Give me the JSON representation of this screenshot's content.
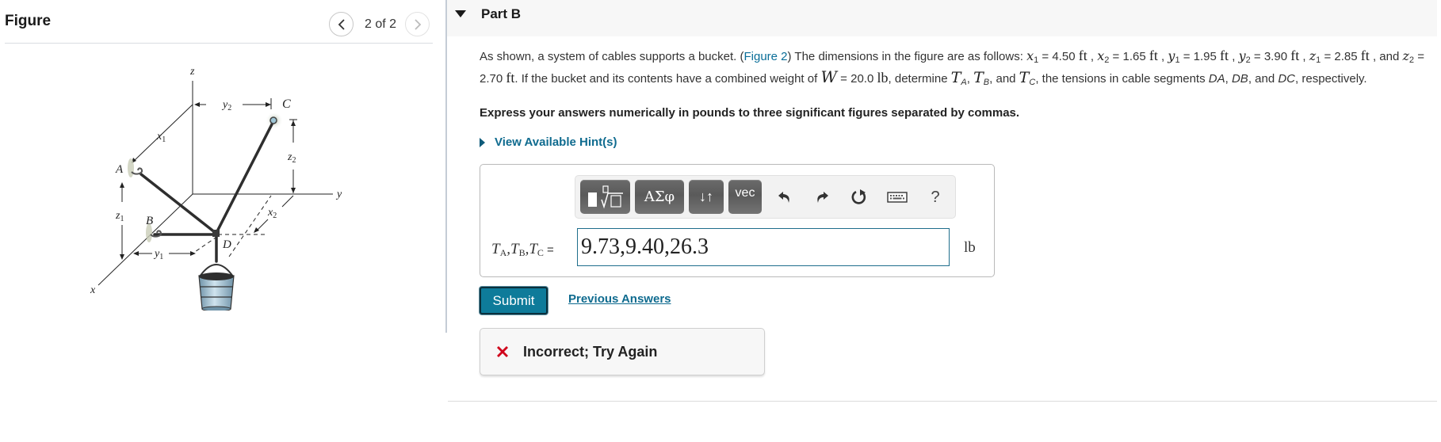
{
  "figure_panel": {
    "title": "Figure",
    "pagination": {
      "current": 2,
      "total": 2,
      "label": "2 of 2"
    },
    "prev_icon": "chevron-left-icon",
    "next_icon": "chevron-right-icon",
    "diagram_labels": {
      "z_axis": "z",
      "y_axis": "y",
      "x_axis": "x",
      "point_a": "A",
      "point_b": "B",
      "point_c": "C",
      "point_d": "D",
      "x1": "x",
      "x1_sub": "1",
      "x2": "x",
      "x2_sub": "2",
      "y1": "y",
      "y1_sub": "1",
      "y2": "y",
      "y2_sub": "2",
      "z1": "z",
      "z1_sub": "1",
      "z2": "z",
      "z2_sub": "2"
    }
  },
  "part": {
    "title": "Part B",
    "toggle_icon": "caret-down-icon"
  },
  "problem": {
    "intro": "As shown, a system of cables supports a bucket. (",
    "figure_link": "Figure 2",
    "after_link": ") The dimensions in the figure are as follows: ",
    "dims": [
      {
        "var": "x",
        "sub": "1",
        "value": "4.50",
        "unit": "ft"
      },
      {
        "var": "x",
        "sub": "2",
        "value": "1.65",
        "unit": "ft"
      },
      {
        "var": "y",
        "sub": "1",
        "value": "1.95",
        "unit": "ft"
      },
      {
        "var": "y",
        "sub": "2",
        "value": "3.90",
        "unit": "ft"
      },
      {
        "var": "z",
        "sub": "1",
        "value": "2.85",
        "unit": "ft"
      },
      {
        "var": "z",
        "sub": "2",
        "value": "2.70",
        "unit": "ft"
      }
    ],
    "weight_text": ". If the bucket and its contents have a combined weight of ",
    "weight": {
      "var": "W",
      "value": "20.0",
      "unit": "lb"
    },
    "determine_text": ", determine ",
    "tensions": [
      {
        "var": "T",
        "sub": "A"
      },
      {
        "var": "T",
        "sub": "B"
      },
      {
        "var": "T",
        "sub": "C"
      }
    ],
    "tail_text": ", the tensions in cable segments ",
    "segments": [
      "DA",
      "DB",
      "DC"
    ],
    "end_text": ", respectively."
  },
  "instruction": "Express your answers numerically in pounds to three significant figures separated by commas.",
  "hints": {
    "label": "View Available Hint(s)",
    "icon": "caret-right-icon"
  },
  "answer": {
    "toolbar": {
      "templates_label": "templates",
      "greek_label": "ΑΣφ",
      "arrows_label": "↓↑",
      "vec_label": "vec",
      "undo_icon": "undo-icon",
      "redo_icon": "redo-icon",
      "reset_icon": "reset-icon",
      "keyboard_icon": "keyboard-icon",
      "help_label": "?"
    },
    "label_parts": [
      {
        "var": "T",
        "sub": "A"
      },
      {
        "var": "T",
        "sub": "B"
      },
      {
        "var": "T",
        "sub": "C"
      }
    ],
    "equals": "=",
    "value": "9.73,9.40,26.3",
    "unit": "lb"
  },
  "actions": {
    "submit_label": "Submit",
    "previous_answers_label": "Previous Answers"
  },
  "feedback": {
    "status": "incorrect",
    "icon": "x-mark-icon",
    "message": "Incorrect; Try Again",
    "color": "#d0021b"
  },
  "colors": {
    "accent": "#0e7b9a",
    "link": "#0f6b8f",
    "error": "#d0021b"
  }
}
